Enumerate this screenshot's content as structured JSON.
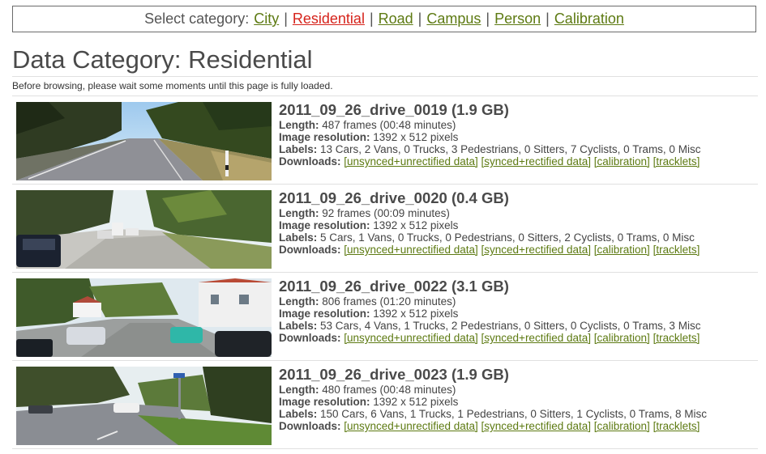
{
  "category_bar": {
    "label": "Select category:",
    "items": [
      "City",
      "Residential",
      "Road",
      "Campus",
      "Person",
      "Calibration"
    ],
    "active": "Residential",
    "separator": "|"
  },
  "title": "Data Category: Residential",
  "note": "Before browsing, please wait some moments until this page is fully loaded.",
  "field_labels": {
    "length": "Length:",
    "resolution": "Image resolution:",
    "labels": "Labels:",
    "downloads": "Downloads:"
  },
  "download_links": [
    "[unsynced+unrectified data]",
    "[synced+rectified data]",
    "[calibration]",
    "[tracklets]"
  ],
  "drives": [
    {
      "name": "2011_09_26_drive_0019 (1.9 GB)",
      "length": "487 frames (00:48 minutes)",
      "resolution": "1392 x 512 pixels",
      "labels": "13 Cars, 2 Vans, 0 Trucks, 3 Pedestrians, 0 Sitters, 7 Cyclists, 0 Trams, 0 Misc"
    },
    {
      "name": "2011_09_26_drive_0020 (0.4 GB)",
      "length": "92 frames (00:09 minutes)",
      "resolution": "1392 x 512 pixels",
      "labels": "5 Cars, 1 Vans, 0 Trucks, 0 Pedestrians, 0 Sitters, 2 Cyclists, 0 Trams, 0 Misc"
    },
    {
      "name": "2011_09_26_drive_0022 (3.1 GB)",
      "length": "806 frames (01:20 minutes)",
      "resolution": "1392 x 512 pixels",
      "labels": "53 Cars, 4 Vans, 1 Trucks, 2 Pedestrians, 0 Sitters, 0 Cyclists, 0 Trams, 3 Misc"
    },
    {
      "name": "2011_09_26_drive_0023 (1.9 GB)",
      "length": "480 frames (00:48 minutes)",
      "resolution": "1392 x 512 pixels",
      "labels": "150 Cars, 6 Vans, 1 Trucks, 1 Pedestrians, 0 Sitters, 1 Cyclists, 0 Trams, 8 Misc"
    }
  ],
  "colors": {
    "link": "#5d7a12",
    "active_link": "#d6231b",
    "text": "#4a4a4a"
  }
}
